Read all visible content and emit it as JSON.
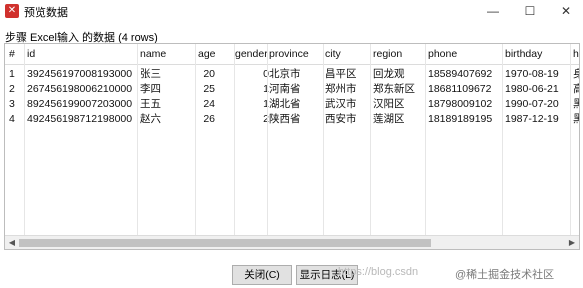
{
  "window": {
    "title": "预览数据",
    "icon": "pdi-icon",
    "buttons": {
      "minimize": "—",
      "maximize": "☐",
      "close": "✕"
    }
  },
  "step_label": "步骤 Excel输入 的数据  (4 rows)",
  "table": {
    "columns": [
      "#",
      "id",
      "name",
      "age",
      "gender",
      "province",
      "city",
      "region",
      "phone",
      "birthday",
      "h"
    ],
    "rows": [
      [
        "1",
        "392456197008193000",
        "张三",
        "20",
        "0",
        "北京市",
        "昌平区",
        "回龙观",
        "18589407692",
        "1970-08-19",
        "身"
      ],
      [
        "2",
        "267456198006210000",
        "李四",
        "25",
        "1",
        "河南省",
        "郑州市",
        "郑东新区",
        "18681109672",
        "1980-06-21",
        "高"
      ],
      [
        "3",
        "892456199007203000",
        "王五",
        "24",
        "1",
        "湖北省",
        "武汉市",
        "汉阳区",
        "18798009102",
        "1990-07-20",
        "黑"
      ],
      [
        "4",
        "492456198712198000",
        "赵六",
        "26",
        "2",
        "陕西省",
        "西安市",
        "莲湖区",
        "18189189195",
        "1987-12-19",
        "黑"
      ]
    ]
  },
  "footer": {
    "close_label": "关闭(C)",
    "log_label": "显示日志(L)",
    "watermark_url": "https://blog.csdn",
    "watermark_brand": "@稀土掘金技术社区"
  }
}
